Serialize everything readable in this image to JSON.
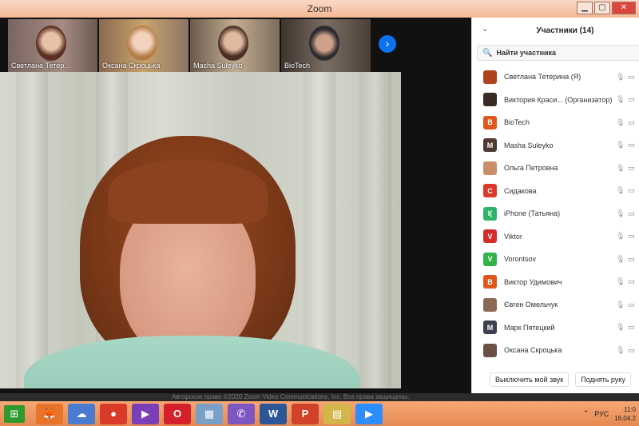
{
  "window": {
    "title": "Zoom",
    "minimize": "▁",
    "maximize": "▢",
    "close": "✕"
  },
  "thumbnails": [
    {
      "name": "Светлана Тетер..."
    },
    {
      "name": "Оксана Скроцька"
    },
    {
      "name": "Masha Suleyko"
    },
    {
      "name": "BioTech"
    }
  ],
  "next_icon": "›",
  "footer_text": "Авторское право ©2020 Zoom Video Communications, Inc. Все права защищены.",
  "panel": {
    "collapse_icon": "⌄",
    "title": "Участники (14)",
    "search_icon": "🔍",
    "search_placeholder": "Найти участника",
    "mic_icon": "🎙",
    "cam_icon": "▭",
    "participants": [
      {
        "initial": "",
        "name": "Светлана Тетерина (Я)",
        "color": "#b0431f"
      },
      {
        "initial": "",
        "name": "Виктория Краси... (Организатор)",
        "color": "#3a2a24"
      },
      {
        "initial": "B",
        "name": "BioTech",
        "color": "#e0561d"
      },
      {
        "initial": "M",
        "name": "Masha Suleyko",
        "color": "#4e3a33"
      },
      {
        "initial": "",
        "name": "Ольга Петровна",
        "color": "#c98d6a"
      },
      {
        "initial": "C",
        "name": "Сидакова",
        "color": "#d93a2a"
      },
      {
        "initial": "I(",
        "name": "iPhone (Татьяна)",
        "color": "#2fb36b"
      },
      {
        "initial": "V",
        "name": "Viktor",
        "color": "#d32b2b"
      },
      {
        "initial": "V",
        "name": "Vorontsov",
        "color": "#33b24a"
      },
      {
        "initial": "B",
        "name": "Виктор Удимович",
        "color": "#e0561d"
      },
      {
        "initial": "",
        "name": "Євген Омельчук",
        "color": "#8a6a56"
      },
      {
        "initial": "M",
        "name": "Марк Пятецкий",
        "color": "#3c3f4e"
      },
      {
        "initial": "",
        "name": "Оксана Скроцька",
        "color": "#6b5145"
      }
    ],
    "mute_label": "Выключить мой звук",
    "raise_hand_label": "Поднять руку"
  },
  "taskbar": {
    "start_icon": "⊞",
    "apps": [
      {
        "icon": "🦊",
        "color": "#e8742a"
      },
      {
        "icon": "☁",
        "color": "#4a7bd0"
      },
      {
        "icon": "●",
        "color": "#d93a2a"
      },
      {
        "icon": "▶",
        "color": "#7b3fb8"
      },
      {
        "icon": "O",
        "color": "#d3202a"
      },
      {
        "icon": "▦",
        "color": "#7aa0c8"
      },
      {
        "icon": "✆",
        "color": "#7d56c2"
      },
      {
        "icon": "W",
        "color": "#2b5797"
      },
      {
        "icon": "P",
        "color": "#d0422a"
      },
      {
        "icon": "▤",
        "color": "#d2b64a"
      },
      {
        "icon": "▶",
        "color": "#2d8cff"
      }
    ],
    "tray_up_icon": "⌃",
    "tray_lang": "РУС",
    "time": "11:0",
    "date": "16.04.2"
  }
}
